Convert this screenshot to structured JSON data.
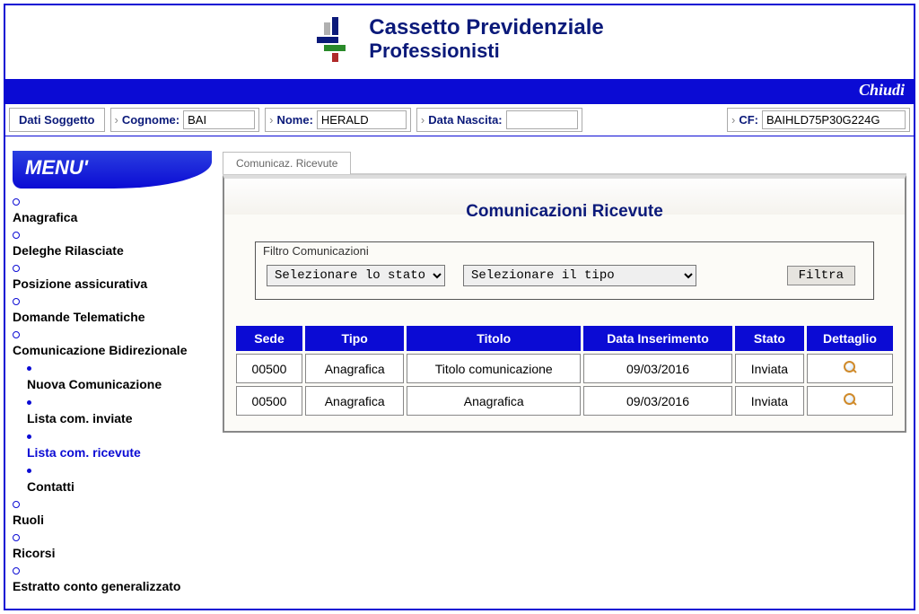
{
  "header": {
    "title_line1": "Cassetto Previdenziale",
    "title_line2": "Professionisti"
  },
  "chiudi_bar": {
    "label": "Chiudi"
  },
  "soggetto": {
    "title": "Dati Soggetto",
    "cognome_label": "Cognome:",
    "cognome_value": "BAI",
    "nome_label": "Nome:",
    "nome_value": "HERALD",
    "nascita_label": "Data Nascita:",
    "nascita_value": "",
    "cf_label": "CF:",
    "cf_value": "BAIHLD75P30G224G"
  },
  "menu": {
    "header": "MENU'",
    "items": [
      "Anagrafica",
      "Deleghe Rilasciate",
      "Posizione assicurativa",
      "Domande Telematiche",
      "Comunicazione Bidirezionale"
    ],
    "sub_items": [
      "Nuova Comunicazione",
      "Lista com. inviate",
      "Lista com. ricevute",
      "Contatti"
    ],
    "items2": [
      "Ruoli",
      "Ricorsi",
      "Estratto conto generalizzato"
    ]
  },
  "tab": {
    "label": "Comunicaz. Ricevute"
  },
  "panel": {
    "title": "Comunicazioni Ricevute",
    "filter_legend": "Filtro Comunicazioni",
    "filter_stato": "Selezionare lo stato",
    "filter_tipo": "Selezionare il tipo",
    "filter_button": "Filtra"
  },
  "table": {
    "headers": [
      "Sede",
      "Tipo",
      "Titolo",
      "Data Inserimento",
      "Stato",
      "Dettaglio"
    ],
    "rows": [
      {
        "sede": "00500",
        "tipo": "Anagrafica",
        "titolo": "Titolo comunicazione",
        "data": "09/03/2016",
        "stato": "Inviata"
      },
      {
        "sede": "00500",
        "tipo": "Anagrafica",
        "titolo": "Anagrafica",
        "data": "09/03/2016",
        "stato": "Inviata"
      }
    ]
  }
}
